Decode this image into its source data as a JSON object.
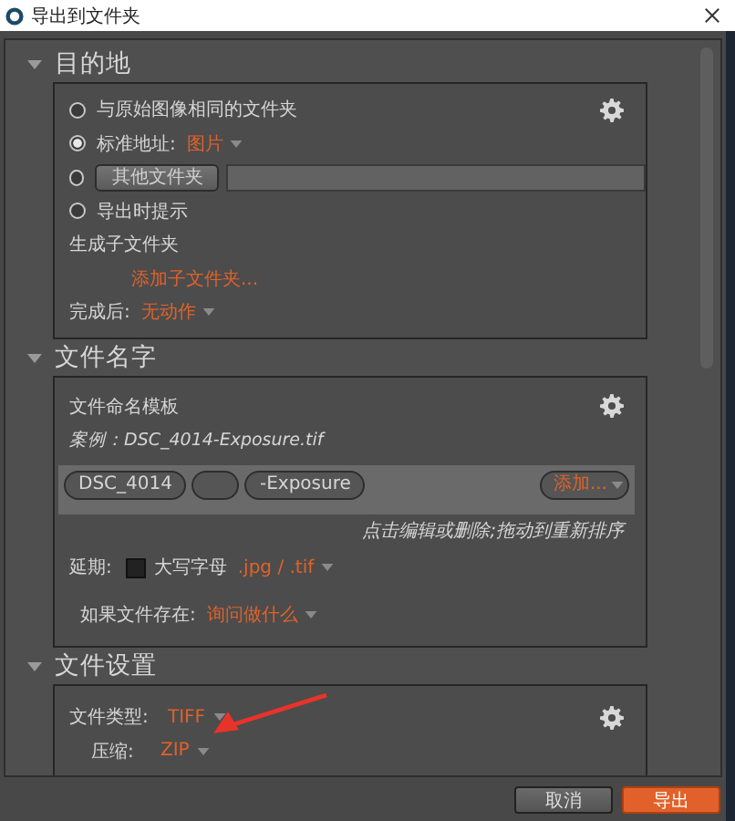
{
  "window": {
    "title": "导出到文件夹"
  },
  "destination": {
    "title": "目的地",
    "expanded": true,
    "options": [
      {
        "kind": "plain",
        "label": "与原始图像相同的文件夹",
        "selected": false
      },
      {
        "kind": "dropdown",
        "label": "标准地址:",
        "value": "图片",
        "selected": true
      },
      {
        "kind": "button",
        "label": "其他文件夹",
        "selected": false
      },
      {
        "kind": "plain",
        "label": "导出时提示",
        "selected": false
      }
    ],
    "subfolder_label": "生成子文件夹",
    "subfolder_link": "添加子文件夹...",
    "after_label": "完成后:",
    "after_value": "无动作"
  },
  "file_name": {
    "title": "文件名字",
    "expanded": true,
    "template_label": "文件命名模板",
    "example": "案例：DSC_4014-Exposure.tif",
    "tokens": [
      {
        "kind": "text",
        "text": "DSC_4014"
      },
      {
        "kind": "blank"
      },
      {
        "kind": "text",
        "text": "-Exposure"
      }
    ],
    "add_button": "添加...",
    "hint": "点击编辑或删除;拖动到重新排序",
    "extension_label": "延期:",
    "uppercase_label": "大写字母",
    "uppercase_checked": false,
    "extension_value": ".jpg / .tif",
    "exists_label": "如果文件存在:",
    "exists_value": "询问做什么"
  },
  "file_settings": {
    "title": "文件设置",
    "expanded": true,
    "type_label": "文件类型:",
    "type_value": "TIFF",
    "compression_label": "压缩:",
    "compression_value": "ZIP"
  },
  "buttons": [
    {
      "kind": "secondary",
      "label": "取消"
    },
    {
      "kind": "primary",
      "label": "导出"
    }
  ]
}
